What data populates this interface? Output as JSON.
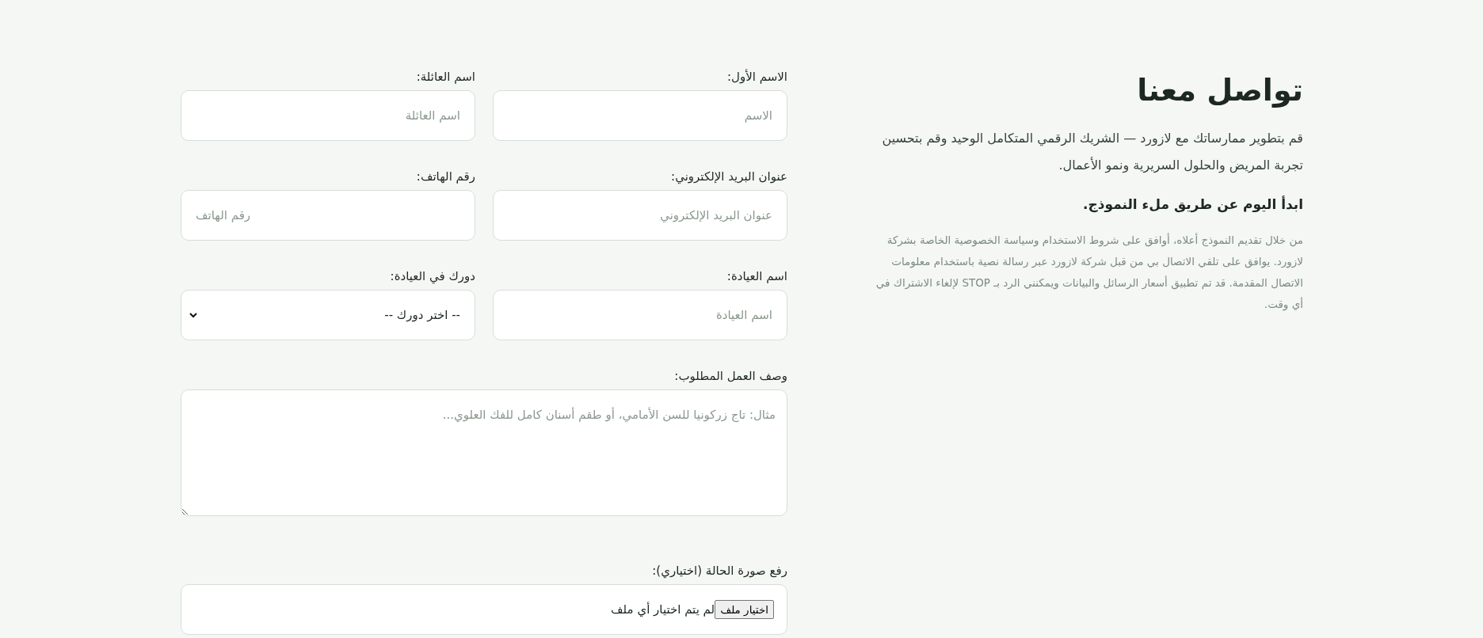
{
  "heading": "تواصل معنا",
  "intro": "قم بتطوير ممارساتك مع لازورد — الشريك الرقمي المتكامل الوحيد وقم بتحسين تجربة المريض والحلول السريرية ونمو الأعمال.",
  "cta": "ابدأ اليوم عن طريق ملء النموذج.",
  "consent": "من خلال تقديم النموذج أعلاه، أوافق على شروط الاستخدام وسياسة الخصوصية الخاصة بشركة لازورد. يوافق على تلقي الاتصال بي من قبل شركة لازورد عبر رسالة نصية باستخدام معلومات الاتصال المقدمة. قد تم تطبيق أسعار الرسائل والبيانات ويمكنني الرد بـ STOP لإلغاء الاشتراك في أي وقت.",
  "fields": [
    {
      "kind": "text",
      "label": "الاسم الأول:",
      "placeholder": "الاسم"
    },
    {
      "kind": "text",
      "label": "اسم العائلة:",
      "placeholder": "اسم العائلة"
    },
    {
      "kind": "text",
      "label": "عنوان البريد الإلكتروني:",
      "placeholder": "عنوان البريد الإلكتروني"
    },
    {
      "kind": "phone",
      "label": "رقم الهاتف:",
      "placeholder": "رقم الهاتف"
    },
    {
      "kind": "text",
      "label": "اسم العيادة:",
      "placeholder": "اسم العيادة"
    },
    {
      "kind": "select",
      "label": "دورك في العيادة:",
      "value": "-- اختر دورك --"
    },
    {
      "kind": "textarea",
      "label": "وصف العمل المطلوب:",
      "placeholder": "مثال: تاج زركونيا للسن الأمامي، أو طقم أسنان كامل للفك العلوي..."
    },
    {
      "kind": "file",
      "label": "رفع صورة الحالة (اختياري):",
      "button": "اختيار ملف",
      "value": "لم يتم اختيار أي ملف"
    }
  ]
}
